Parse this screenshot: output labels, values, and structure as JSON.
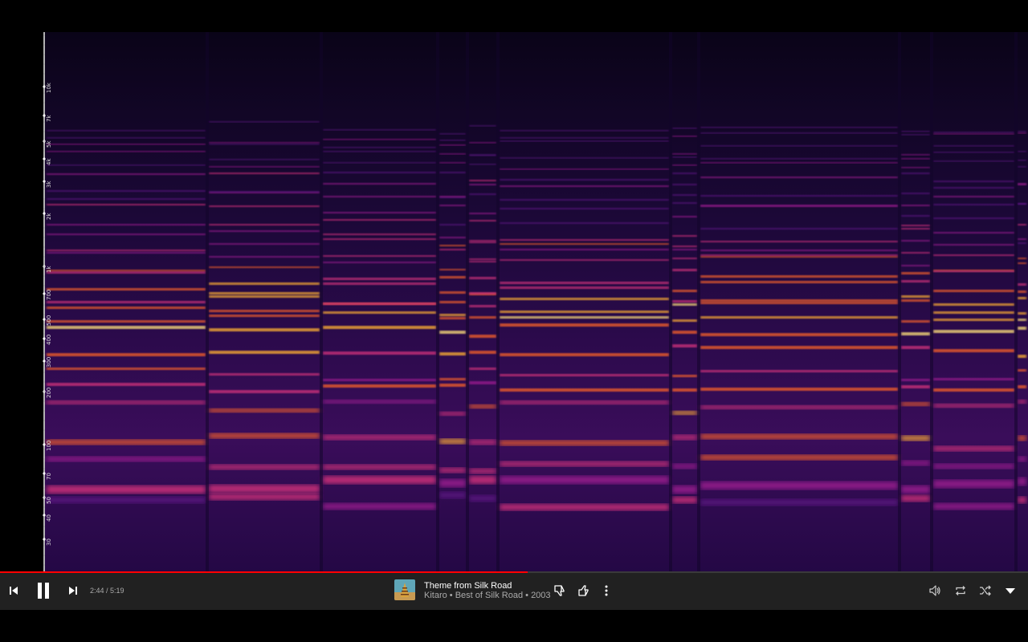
{
  "spectrogram": {
    "freq_ticks": [
      "10k",
      "7k",
      "5k",
      "4k",
      "3k",
      "2k",
      "1k",
      "700",
      "500",
      "400",
      "300",
      "200",
      "100",
      "70",
      "50",
      "40",
      "30"
    ]
  },
  "player": {
    "progress": 0.513,
    "time": "2:44 / 5:19",
    "accent_color": "#ff0000",
    "controls": {
      "previous": "previous-icon",
      "play_pause": "pause-icon",
      "next": "next-icon",
      "dislike": "thumb-down-icon",
      "like": "thumb-up-icon",
      "more": "more-vert-icon",
      "volume": "volume-icon",
      "repeat": "repeat-icon",
      "shuffle": "shuffle-icon",
      "expand": "expand-triangle-icon"
    },
    "track": {
      "title": "Theme from Silk Road",
      "artist": "Kitaro",
      "album": "Best of Silk Road",
      "year": "2003",
      "separator": " • "
    }
  }
}
